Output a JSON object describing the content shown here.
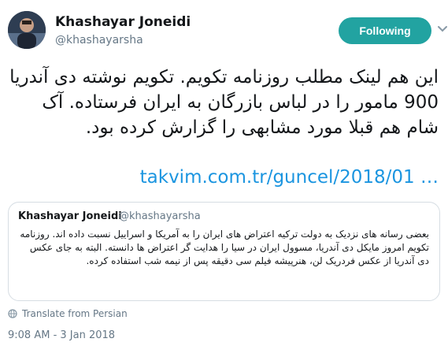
{
  "author": {
    "display_name": "Khashayar Joneidi",
    "handle": "@khashayarsha"
  },
  "follow_button": {
    "label": "Following"
  },
  "tweet": {
    "text": "این هم لینک مطلب روزنامه تکویم. تکویم نوشته دی آندریا 900 مامور را در لباس بازرگان به ایران فرستاده. آک شام هم قبلا مورد مشابهی را گزارش کرده بود.",
    "link": "takvim.com.tr/guncel/2018/01 …"
  },
  "quoted_tweet": {
    "display_name": "Khashayar Joneidi",
    "handle": "@khashayarsha",
    "text": "بعضی رسانه های نزدیک به دولت ترکیه اعتراض های ایران را به آمریکا و اسراییل نسبت داده اند. روزنامه تکویم امروز مایکل دی آندریا، مسوول ایران در سیا را هدایت گر اعتراض ها دانسته. البته به جای عکس دی آندریا از عکس فردریک لن، هنرپیشه فیلم سی دقیقه پس از نیمه شب استفاده کرده."
  },
  "translate": {
    "label": "Translate from Persian",
    "icon": "globe-icon"
  },
  "timestamp": "9:08 AM - 3 Jan 2018",
  "colors": {
    "follow_button_bg": "#22a3a1",
    "link": "#1b95e0",
    "muted": "#657786"
  }
}
